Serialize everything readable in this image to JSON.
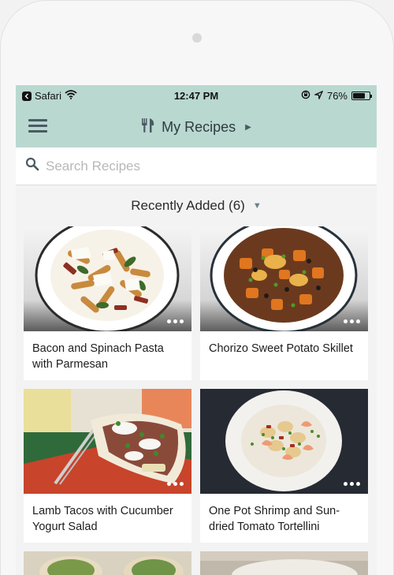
{
  "status_bar": {
    "carrier": "Safari",
    "time": "12:47 PM",
    "battery": "76%",
    "battery_level": 0.76
  },
  "nav": {
    "title": "My Recipes"
  },
  "search": {
    "placeholder": "Search Recipes",
    "value": ""
  },
  "filter": {
    "label": "Recently Added (6)"
  },
  "recipes": [
    {
      "title": "Bacon and Spinach Pasta with Parmesan"
    },
    {
      "title": "Chorizo Sweet Potato Skillet"
    },
    {
      "title": "Lamb Tacos with Cucumber Yogurt Salad"
    },
    {
      "title": "One Pot Shrimp and Sun-dried Tomato Tortellini"
    }
  ],
  "colors": {
    "header_bg": "#b9d8d0",
    "icon": "#4a5a63",
    "card_bg": "#ffffff"
  }
}
